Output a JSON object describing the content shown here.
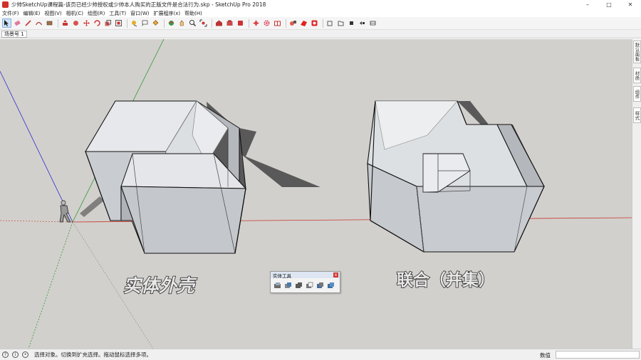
{
  "window": {
    "title": "少帅SketchUp课程篇-该页已经少帅授权或少帅本人购买的正版文件是合法行为.skp - SketchUp Pro 2018",
    "minimize": "–",
    "maximize": "□",
    "close": "✕"
  },
  "menu": [
    "文件(F)",
    "编辑(E)",
    "视图(V)",
    "相机(C)",
    "绘图(R)",
    "工具(T)",
    "窗口(W)",
    "扩展程序(x)",
    "帮助(H)"
  ],
  "scene_tab": "场景号 1",
  "tray_tabs": [
    "默认面板",
    "材质",
    "组件",
    "样式"
  ],
  "labels": {
    "left": "实体外壳",
    "right": "联合（并集）"
  },
  "solid_panel": {
    "title": "实体工具",
    "close": "x"
  },
  "status": {
    "text": "选择对象。切换到扩充选择。拖动鼠标选择多项。",
    "measure_label": "数值",
    "measure_value": ""
  },
  "colors": {
    "viewport_bg": "#d2d0cc",
    "axis_red": "#c8362e",
    "axis_green": "#2f9a37",
    "axis_blue": "#2b2bd1",
    "shadow": "#5a5959"
  }
}
